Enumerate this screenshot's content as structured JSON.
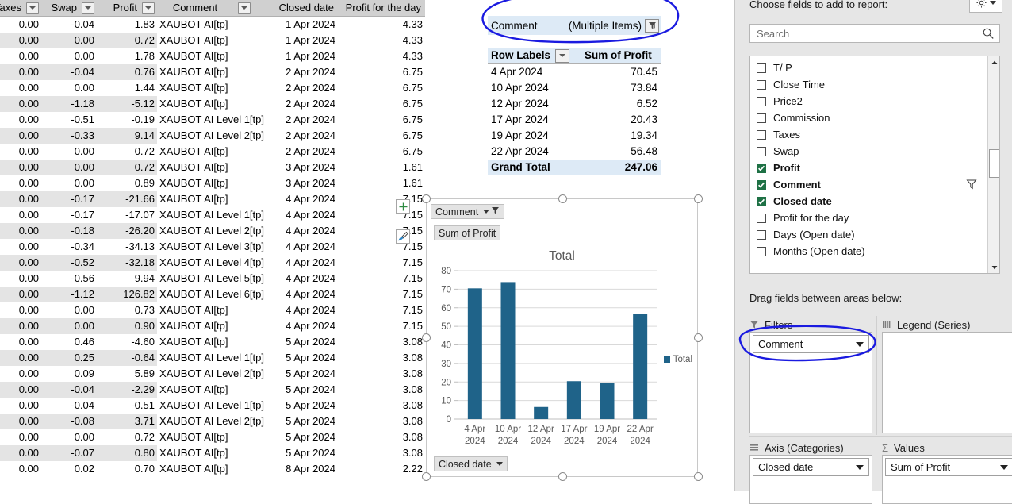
{
  "worksheet": {
    "columns": [
      {
        "key": "taxes",
        "label": "Taxes",
        "filter": true
      },
      {
        "key": "swap",
        "label": "Swap",
        "filter": true
      },
      {
        "key": "profit",
        "label": "Profit",
        "filter": true
      },
      {
        "key": "comment",
        "label": "Comment",
        "filter": true
      },
      {
        "key": "closed_date",
        "label": "Closed date",
        "filter": false
      },
      {
        "key": "profit_for_the_day",
        "label": "Profit for the day",
        "filter": false
      }
    ],
    "rows": [
      {
        "taxes": "0.00",
        "swap": "-0.04",
        "profit": "1.83",
        "comment": "XAUBOT AI[tp]",
        "closed_date": "1 Apr 2024",
        "profit_for_the_day": "4.33"
      },
      {
        "taxes": "0.00",
        "swap": "0.00",
        "profit": "0.72",
        "comment": "XAUBOT AI[tp]",
        "closed_date": "1 Apr 2024",
        "profit_for_the_day": "4.33"
      },
      {
        "taxes": "0.00",
        "swap": "0.00",
        "profit": "1.78",
        "comment": "XAUBOT AI[tp]",
        "closed_date": "1 Apr 2024",
        "profit_for_the_day": "4.33"
      },
      {
        "taxes": "0.00",
        "swap": "-0.04",
        "profit": "0.76",
        "comment": "XAUBOT AI[tp]",
        "closed_date": "2 Apr 2024",
        "profit_for_the_day": "6.75"
      },
      {
        "taxes": "0.00",
        "swap": "0.00",
        "profit": "1.44",
        "comment": "XAUBOT AI[tp]",
        "closed_date": "2 Apr 2024",
        "profit_for_the_day": "6.75"
      },
      {
        "taxes": "0.00",
        "swap": "-1.18",
        "profit": "-5.12",
        "comment": "XAUBOT AI[tp]",
        "closed_date": "2 Apr 2024",
        "profit_for_the_day": "6.75"
      },
      {
        "taxes": "0.00",
        "swap": "-0.51",
        "profit": "-0.19",
        "comment": "XAUBOT AI Level 1[tp]",
        "closed_date": "2 Apr 2024",
        "profit_for_the_day": "6.75"
      },
      {
        "taxes": "0.00",
        "swap": "-0.33",
        "profit": "9.14",
        "comment": "XAUBOT AI Level 2[tp]",
        "closed_date": "2 Apr 2024",
        "profit_for_the_day": "6.75"
      },
      {
        "taxes": "0.00",
        "swap": "0.00",
        "profit": "0.72",
        "comment": "XAUBOT AI[tp]",
        "closed_date": "2 Apr 2024",
        "profit_for_the_day": "6.75"
      },
      {
        "taxes": "0.00",
        "swap": "0.00",
        "profit": "0.72",
        "comment": "XAUBOT AI[tp]",
        "closed_date": "3 Apr 2024",
        "profit_for_the_day": "1.61"
      },
      {
        "taxes": "0.00",
        "swap": "0.00",
        "profit": "0.89",
        "comment": "XAUBOT AI[tp]",
        "closed_date": "3 Apr 2024",
        "profit_for_the_day": "1.61"
      },
      {
        "taxes": "0.00",
        "swap": "-0.17",
        "profit": "-21.66",
        "comment": "XAUBOT AI[tp]",
        "closed_date": "4 Apr 2024",
        "profit_for_the_day": "7.15"
      },
      {
        "taxes": "0.00",
        "swap": "-0.17",
        "profit": "-17.07",
        "comment": "XAUBOT AI Level 1[tp]",
        "closed_date": "4 Apr 2024",
        "profit_for_the_day": "7.15"
      },
      {
        "taxes": "0.00",
        "swap": "-0.18",
        "profit": "-26.20",
        "comment": "XAUBOT AI Level 2[tp]",
        "closed_date": "4 Apr 2024",
        "profit_for_the_day": "7.15"
      },
      {
        "taxes": "0.00",
        "swap": "-0.34",
        "profit": "-34.13",
        "comment": "XAUBOT AI Level 3[tp]",
        "closed_date": "4 Apr 2024",
        "profit_for_the_day": "7.15"
      },
      {
        "taxes": "0.00",
        "swap": "-0.52",
        "profit": "-32.18",
        "comment": "XAUBOT AI Level 4[tp]",
        "closed_date": "4 Apr 2024",
        "profit_for_the_day": "7.15"
      },
      {
        "taxes": "0.00",
        "swap": "-0.56",
        "profit": "9.94",
        "comment": "XAUBOT AI Level 5[tp]",
        "closed_date": "4 Apr 2024",
        "profit_for_the_day": "7.15"
      },
      {
        "taxes": "0.00",
        "swap": "-1.12",
        "profit": "126.82",
        "comment": "XAUBOT AI Level 6[tp]",
        "closed_date": "4 Apr 2024",
        "profit_for_the_day": "7.15"
      },
      {
        "taxes": "0.00",
        "swap": "0.00",
        "profit": "0.73",
        "comment": "XAUBOT AI[tp]",
        "closed_date": "4 Apr 2024",
        "profit_for_the_day": "7.15"
      },
      {
        "taxes": "0.00",
        "swap": "0.00",
        "profit": "0.90",
        "comment": "XAUBOT AI[tp]",
        "closed_date": "4 Apr 2024",
        "profit_for_the_day": "7.15"
      },
      {
        "taxes": "0.00",
        "swap": "0.46",
        "profit": "-4.60",
        "comment": "XAUBOT AI[tp]",
        "closed_date": "5 Apr 2024",
        "profit_for_the_day": "3.08"
      },
      {
        "taxes": "0.00",
        "swap": "0.25",
        "profit": "-0.64",
        "comment": "XAUBOT AI Level 1[tp]",
        "closed_date": "5 Apr 2024",
        "profit_for_the_day": "3.08"
      },
      {
        "taxes": "0.00",
        "swap": "0.09",
        "profit": "5.89",
        "comment": "XAUBOT AI Level 2[tp]",
        "closed_date": "5 Apr 2024",
        "profit_for_the_day": "3.08"
      },
      {
        "taxes": "0.00",
        "swap": "-0.04",
        "profit": "-2.29",
        "comment": "XAUBOT AI[tp]",
        "closed_date": "5 Apr 2024",
        "profit_for_the_day": "3.08"
      },
      {
        "taxes": "0.00",
        "swap": "-0.04",
        "profit": "-0.51",
        "comment": "XAUBOT AI Level 1[tp]",
        "closed_date": "5 Apr 2024",
        "profit_for_the_day": "3.08"
      },
      {
        "taxes": "0.00",
        "swap": "-0.08",
        "profit": "3.71",
        "comment": "XAUBOT AI Level 2[tp]",
        "closed_date": "5 Apr 2024",
        "profit_for_the_day": "3.08"
      },
      {
        "taxes": "0.00",
        "swap": "0.00",
        "profit": "0.72",
        "comment": "XAUBOT AI[tp]",
        "closed_date": "5 Apr 2024",
        "profit_for_the_day": "3.08"
      },
      {
        "taxes": "0.00",
        "swap": "-0.07",
        "profit": "0.80",
        "comment": "XAUBOT AI[tp]",
        "closed_date": "5 Apr 2024",
        "profit_for_the_day": "3.08"
      },
      {
        "taxes": "0.00",
        "swap": "0.02",
        "profit": "0.70",
        "comment": "XAUBOT AI[tp]",
        "closed_date": "8 Apr 2024",
        "profit_for_the_day": "2.22"
      }
    ]
  },
  "pivot": {
    "report_filter": {
      "field": "Comment",
      "value": "(Multiple Items)"
    },
    "headers": {
      "row_labels": "Row Labels",
      "value": "Sum of Profit"
    },
    "rows": [
      {
        "label": "4 Apr 2024",
        "value": "70.45"
      },
      {
        "label": "10 Apr 2024",
        "value": "73.84"
      },
      {
        "label": "12 Apr 2024",
        "value": "6.52"
      },
      {
        "label": "17 Apr 2024",
        "value": "20.43"
      },
      {
        "label": "19 Apr 2024",
        "value": "19.34"
      },
      {
        "label": "22 Apr 2024",
        "value": "56.48"
      }
    ],
    "grand_total": {
      "label": "Grand Total",
      "value": "247.06"
    }
  },
  "chart": {
    "filter_button_label": "Comment",
    "value_button_label": "Sum of Profit",
    "axis_button_label": "Closed date",
    "title": "Total",
    "legend": [
      "Total"
    ],
    "series_color": "#1f6389"
  },
  "chart_data": {
    "type": "bar",
    "title": "Total",
    "categories": [
      "4 Apr 2024",
      "10 Apr 2024",
      "12 Apr 2024",
      "17 Apr 2024",
      "19 Apr 2024",
      "22 Apr 2024"
    ],
    "category_lines": [
      [
        "4 Apr",
        "2024"
      ],
      [
        "10 Apr",
        "2024"
      ],
      [
        "12 Apr",
        "2024"
      ],
      [
        "17 Apr",
        "2024"
      ],
      [
        "19 Apr",
        "2024"
      ],
      [
        "22 Apr",
        "2024"
      ]
    ],
    "series": [
      {
        "name": "Total",
        "values": [
          70.45,
          73.84,
          6.52,
          20.43,
          19.34,
          56.48
        ],
        "color": "#1f6389"
      }
    ],
    "xlabel": "",
    "ylabel": "",
    "ylim": [
      0,
      80
    ],
    "yticks": [
      0,
      10,
      20,
      30,
      40,
      50,
      60,
      70,
      80
    ],
    "grid": true,
    "legend_position": "right"
  },
  "pane": {
    "choose_fields_label": "Choose fields to add to report:",
    "gear_tooltip": "Tools",
    "search": {
      "placeholder": "Search",
      "value": ""
    },
    "fields": [
      {
        "label": "T/ P",
        "checked": false,
        "filter": false
      },
      {
        "label": "Close Time",
        "checked": false,
        "filter": false
      },
      {
        "label": "Price2",
        "checked": false,
        "filter": false
      },
      {
        "label": "Commission",
        "checked": false,
        "filter": false
      },
      {
        "label": "Taxes",
        "checked": false,
        "filter": false
      },
      {
        "label": "Swap",
        "checked": false,
        "filter": false
      },
      {
        "label": "Profit",
        "checked": true,
        "filter": false
      },
      {
        "label": "Comment",
        "checked": true,
        "filter": true
      },
      {
        "label": "Closed date",
        "checked": true,
        "filter": false
      },
      {
        "label": "Profit for the day",
        "checked": false,
        "filter": false
      },
      {
        "label": "Days (Open date)",
        "checked": false,
        "filter": false
      },
      {
        "label": "Months (Open date)",
        "checked": false,
        "filter": false
      }
    ],
    "drag_label": "Drag fields between areas below:",
    "areas": [
      {
        "id": "filters",
        "title": "Filters",
        "icon": "funnel-icon",
        "chips": [
          "Comment"
        ]
      },
      {
        "id": "legend",
        "title": "Legend (Series)",
        "icon": "columns-icon",
        "chips": []
      },
      {
        "id": "axis",
        "title": "Axis (Categories)",
        "icon": "rows-icon",
        "chips": [
          "Closed date"
        ]
      },
      {
        "id": "values",
        "title": "Values",
        "icon": "sigma-icon",
        "chips": [
          "Sum of Profit"
        ]
      }
    ]
  },
  "annotations": {
    "color": "#1a1ae0",
    "items": [
      {
        "name": "pivot-filter-circle",
        "shape": "ellipse"
      },
      {
        "name": "filters-area-circle",
        "shape": "ellipse"
      }
    ]
  }
}
